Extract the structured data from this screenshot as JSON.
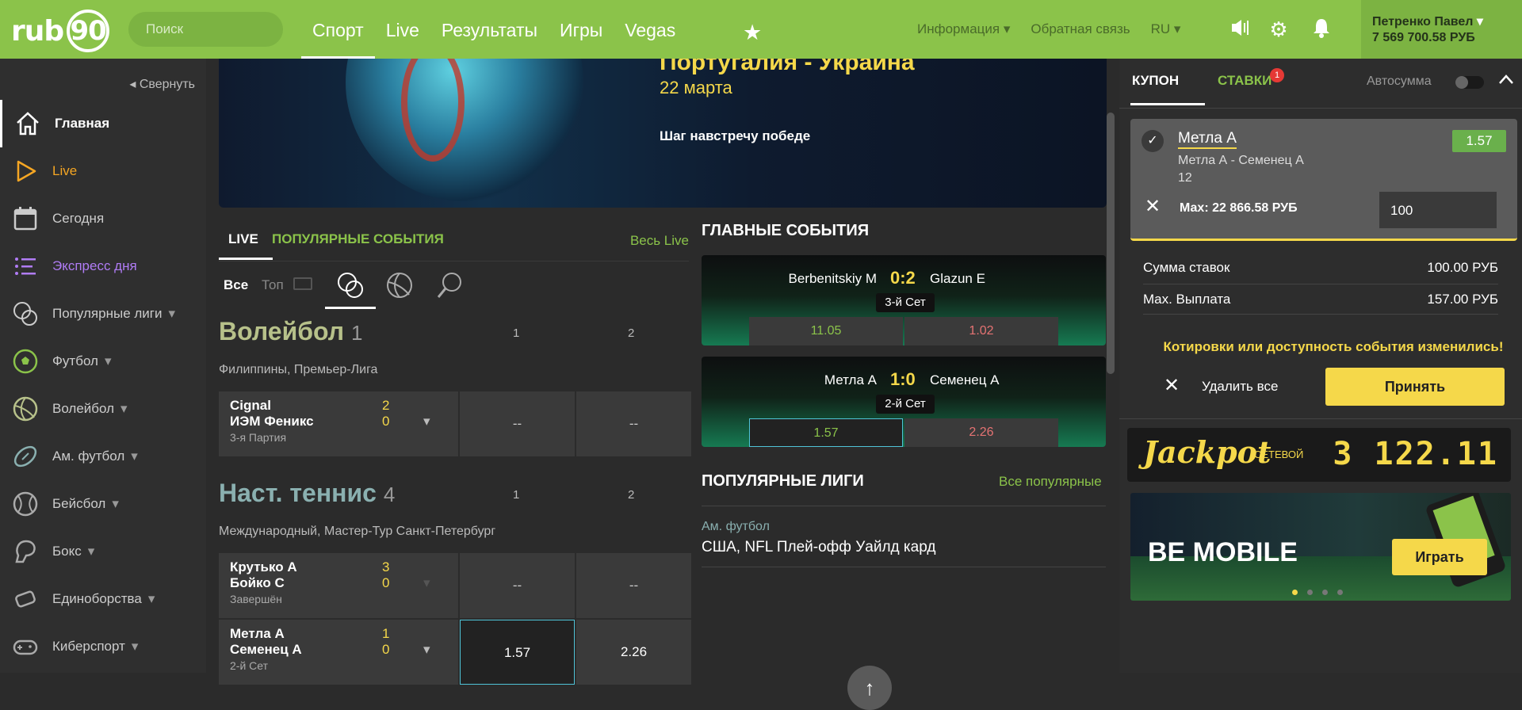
{
  "header": {
    "logo_text": "rub",
    "logo_num": "90",
    "search_placeholder": "Поиск",
    "nav": [
      "Спорт",
      "Live",
      "Результаты",
      "Игры",
      "Vegas"
    ],
    "info": "Информация",
    "feedback": "Обратная связь",
    "lang": "RU",
    "user_name": "Петренко Павел",
    "balance": "7 569 700.58 РУБ"
  },
  "sidebar": {
    "collapse": "Свернуть",
    "items": [
      {
        "label": "Главная",
        "icon": "home-icon",
        "color": "#ffffff"
      },
      {
        "label": "Live",
        "icon": "play-icon",
        "color": "#f5a623"
      },
      {
        "label": "Сегодня",
        "icon": "calendar-icon",
        "color": "#cccccc"
      },
      {
        "label": "Экспресс дня",
        "icon": "list-icon",
        "color": "#b07cf5"
      },
      {
        "label": "Популярные лиги",
        "icon": "balls-icon",
        "color": "#cccccc"
      },
      {
        "label": "Футбол",
        "icon": "football-icon",
        "color": "#cccccc"
      },
      {
        "label": "Волейбол",
        "icon": "volleyball-icon",
        "color": "#cccccc"
      },
      {
        "label": "Ам. футбол",
        "icon": "american-football-icon",
        "color": "#cccccc"
      },
      {
        "label": "Бейсбол",
        "icon": "baseball-icon",
        "color": "#cccccc"
      },
      {
        "label": "Бокс",
        "icon": "boxing-glove-icon",
        "color": "#cccccc"
      },
      {
        "label": "Единоборства",
        "icon": "fist-icon",
        "color": "#cccccc"
      },
      {
        "label": "Киберспорт",
        "icon": "gamepad-icon",
        "color": "#cccccc"
      }
    ]
  },
  "banner": {
    "title_partial": "Португалия - Украина",
    "date": "22 марта",
    "slogan": "Шаг навстречу победе"
  },
  "live": {
    "tab_live": "LIVE",
    "tab_popular": "ПОПУЛЯРНЫЕ СОБЫТИЯ",
    "all_live": "Весь Live",
    "filter_all": "Все",
    "filter_top": "Топ",
    "sections": [
      {
        "sport": "Волейбол",
        "count": "1",
        "league": "Филиппины, Премьер-Лига",
        "col1": "1",
        "col2": "2",
        "rows": [
          {
            "team1": "Cignal",
            "team2": "ИЭМ Феникс",
            "s1": "2",
            "s2": "0",
            "status": "3-я Партия",
            "o1": "--",
            "o2": "--"
          }
        ]
      },
      {
        "sport": "Наст. теннис",
        "count": "4",
        "league": "Международный, Мастер-Тур Санкт-Петербург",
        "col1": "1",
        "col2": "2",
        "rows": [
          {
            "team1": "Крутько А",
            "team2": "Бойко С",
            "s1": "3",
            "s2": "0",
            "status": "Завершён",
            "o1": "--",
            "o2": "--"
          },
          {
            "team1": "Метла А",
            "team2": "Семенец А",
            "s1": "1",
            "s2": "0",
            "status": "2-й Сет",
            "o1": "1.57",
            "o2": "2.26"
          }
        ]
      }
    ]
  },
  "main_events": {
    "title": "ГЛАВНЫЕ СОБЫТИЯ",
    "matches": [
      {
        "p1": "Berbenitskiy M",
        "p2": "Glazun E",
        "score": "0:2",
        "set": "3-й Сет",
        "o1": "11.05",
        "o2": "1.02"
      },
      {
        "p1": "Метла А",
        "p2": "Семенец А",
        "score": "1:0",
        "set": "2-й Сет",
        "o1": "1.57",
        "o2": "2.26"
      }
    ]
  },
  "popular_leagues": {
    "title": "ПОПУЛЯРНЫЕ ЛИГИ",
    "all": "Все популярные",
    "items": [
      {
        "sport": "Ам. футбол",
        "name": "США, NFL Плей-офф Уайлд кард"
      }
    ]
  },
  "coupon": {
    "tab_coupon": "КУПОН",
    "tab_bets": "СТАВКИ",
    "bets_badge": "1",
    "autosum": "Автосумма",
    "selection": "Метла А",
    "match": "Метла А - Семенец А",
    "market": "12",
    "odd": "1.57",
    "max": "Мах: 22 866.58 РУБ",
    "stake": "100",
    "sum_label": "Сумма ставок",
    "sum_value": "100.00 РУБ",
    "payout_label": "Max. Выплата",
    "payout_value": "157.00 РУБ",
    "warning": "Котировки или доступность события изменились!",
    "delete_all": "Удалить все",
    "accept": "Принять"
  },
  "jackpot": {
    "title": "Jackpot",
    "sub": "СЕТЕВОЙ",
    "value": "3 122.11"
  },
  "promo": {
    "title": "BE MOBILE",
    "button": "Играть"
  }
}
